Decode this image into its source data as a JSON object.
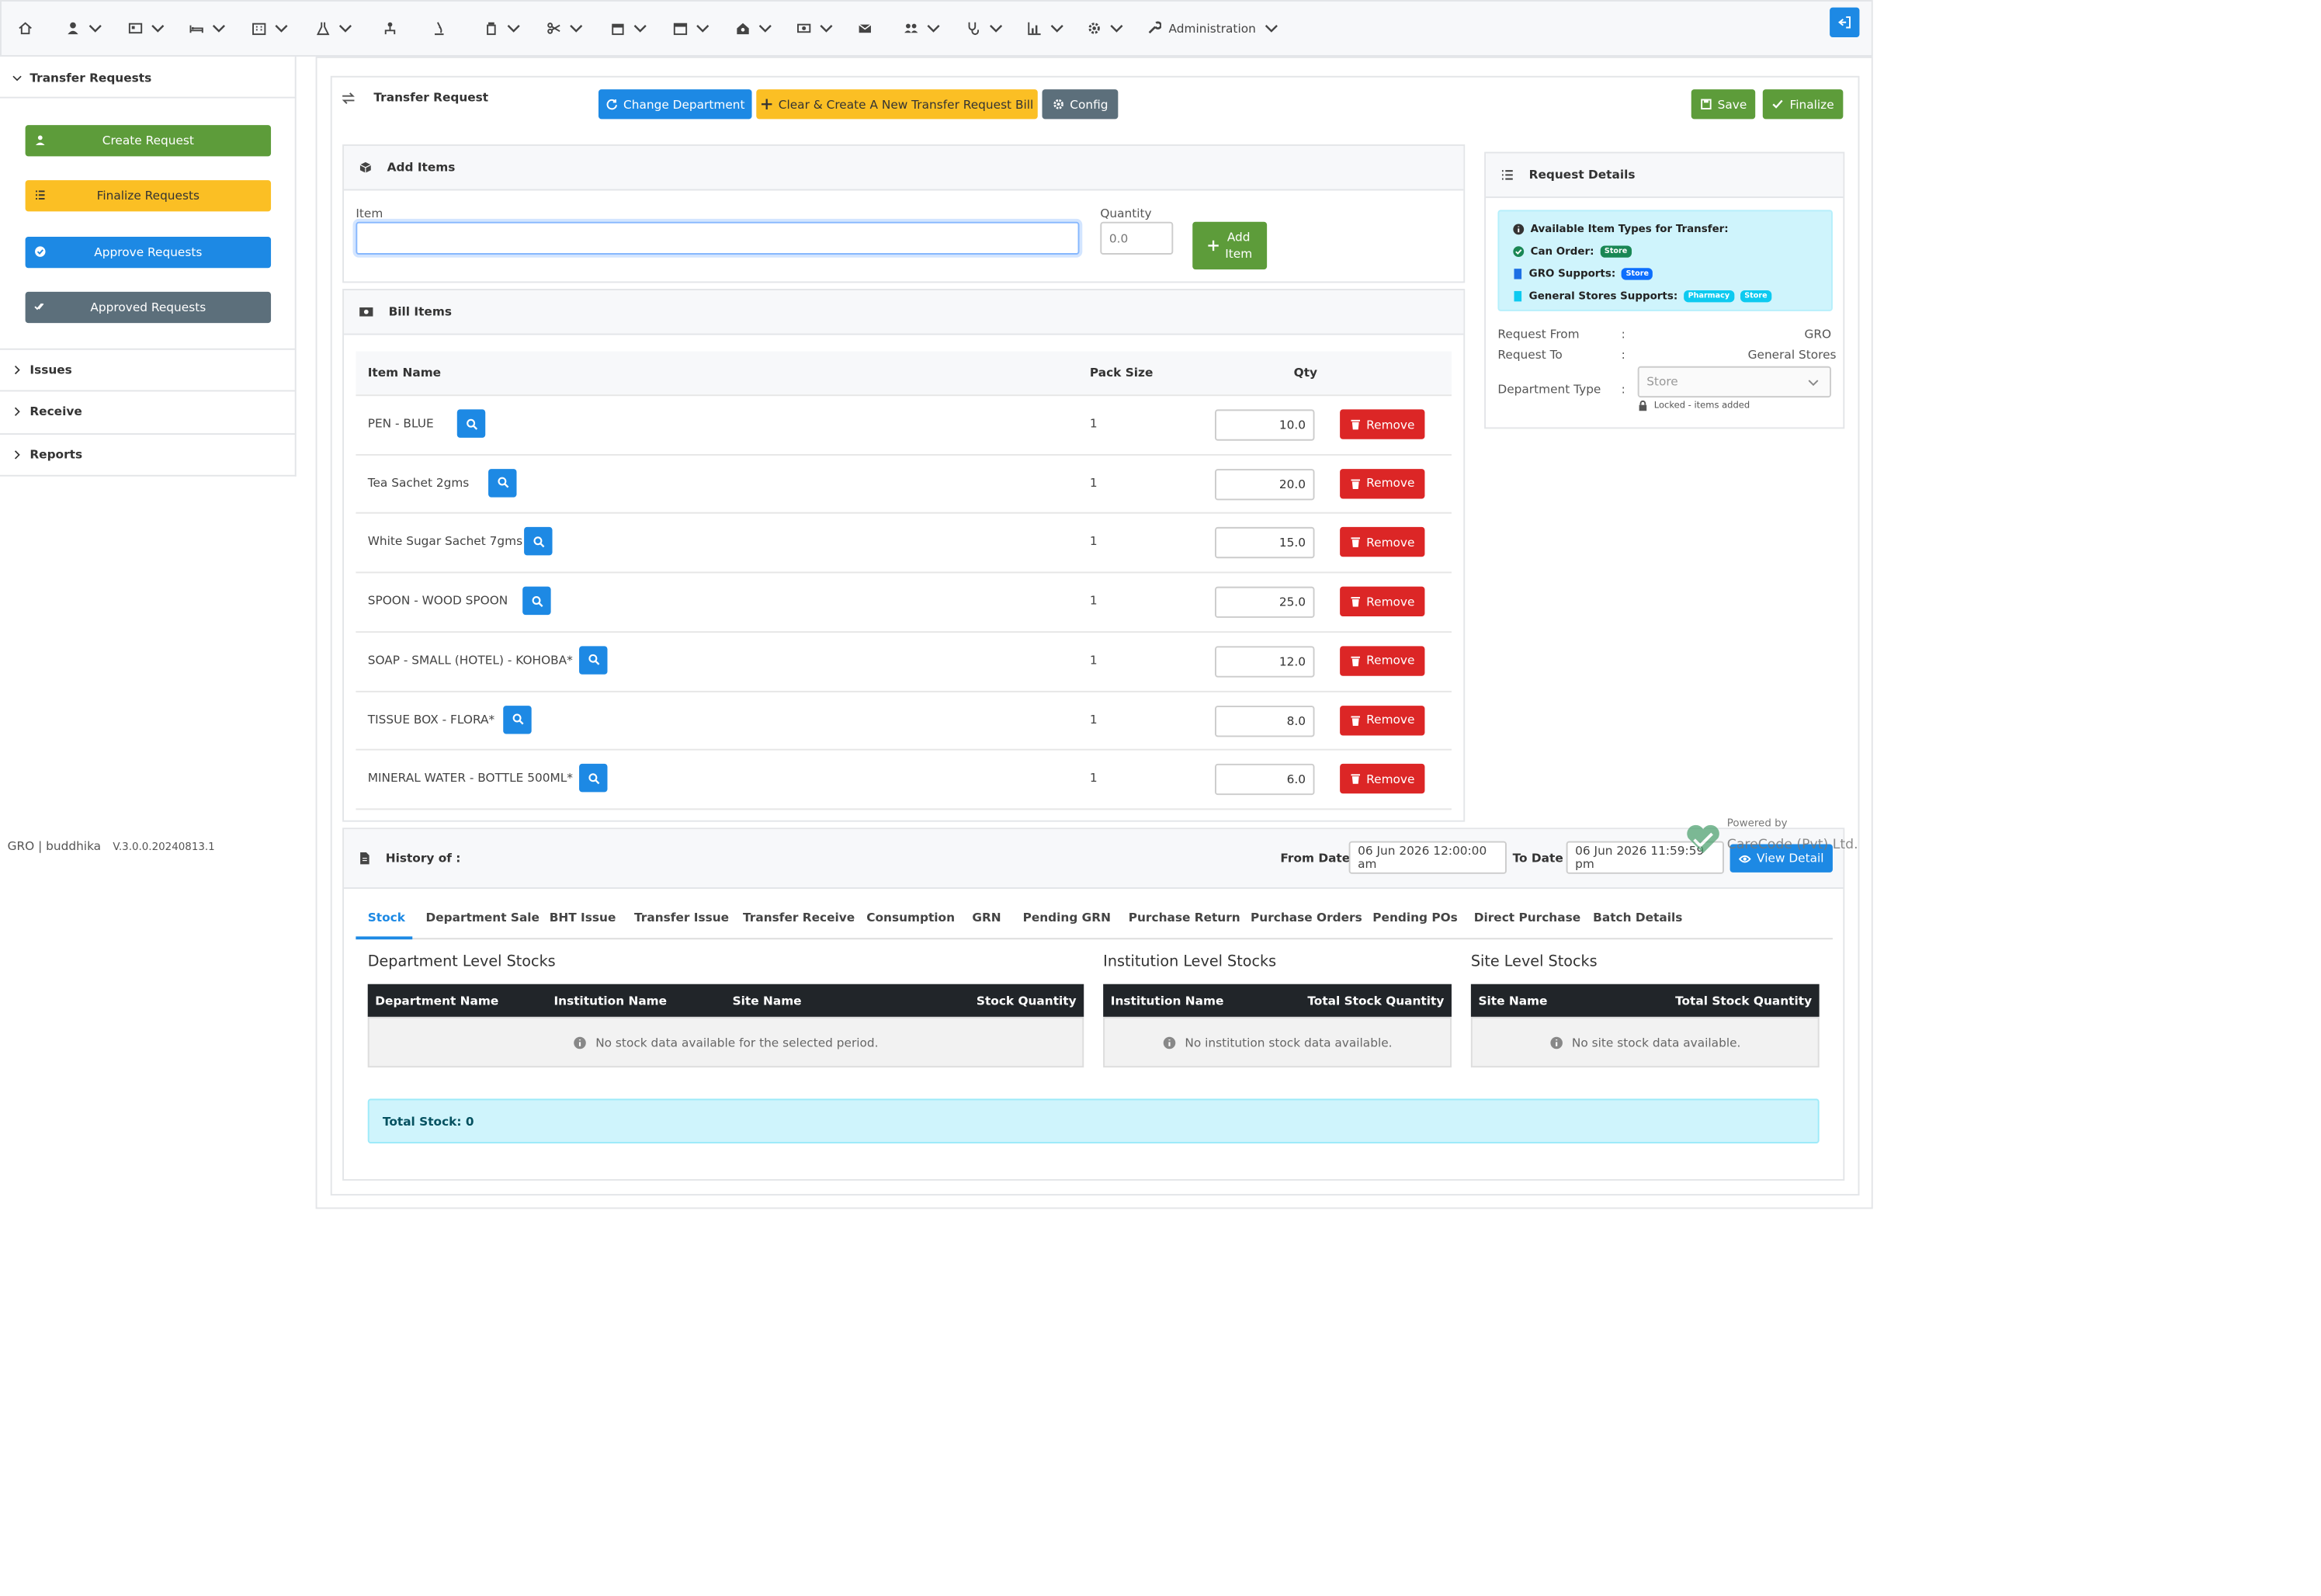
{
  "nav": {
    "administration_label": "Administration"
  },
  "sidebar": {
    "section_title": "Transfer Requests",
    "buttons": [
      "Create Request",
      "Finalize Requests",
      "Approve Requests",
      "Approved Requests"
    ],
    "sections": [
      "Issues",
      "Receive",
      "Reports"
    ]
  },
  "footer": {
    "user": "GRO | buddhika",
    "version": "V.3.0.0.20240813.1",
    "powered_by": "Powered by",
    "company": "CareCode (Pvt) Ltd."
  },
  "header": {
    "title": "Transfer Request",
    "change_department": "Change Department",
    "clear_create": "Clear & Create A New Transfer Request Bill",
    "config": "Config",
    "save": "Save",
    "finalize": "Finalize"
  },
  "add_items": {
    "title": "Add Items",
    "item_label": "Item",
    "item_value": "",
    "quantity_label": "Quantity",
    "quantity_placeholder": "0.0",
    "add_item_line1": "Add",
    "add_item_line2": "Item"
  },
  "bill_items": {
    "title": "Bill Items",
    "headers": {
      "item_name": "Item Name",
      "pack_size": "Pack Size",
      "qty": "Qty"
    },
    "remove_label": "Remove",
    "rows": [
      {
        "name": "PEN - BLUE",
        "pack": "1",
        "qty": "10.0"
      },
      {
        "name": "Tea Sachet 2gms",
        "pack": "1",
        "qty": "20.0"
      },
      {
        "name": "White Sugar Sachet 7gms",
        "pack": "1",
        "qty": "15.0"
      },
      {
        "name": "SPOON - WOOD SPOON",
        "pack": "1",
        "qty": "25.0"
      },
      {
        "name": "SOAP - SMALL (HOTEL) - KOHOBA*",
        "pack": "1",
        "qty": "12.0"
      },
      {
        "name": "TISSUE BOX - FLORA*",
        "pack": "1",
        "qty": "8.0"
      },
      {
        "name": "MINERAL WATER - BOTTLE 500ML*",
        "pack": "1",
        "qty": "6.0"
      }
    ]
  },
  "request_details": {
    "title": "Request Details",
    "info_title": "Available Item Types for Transfer:",
    "can_order_label": "Can Order:",
    "can_order_badge": "Store",
    "gro_supports_label": "GRO Supports:",
    "gro_supports_badge": "Store",
    "general_stores_label": "General Stores Supports:",
    "general_stores_badges": [
      "Pharmacy",
      "Store"
    ],
    "request_from_label": "Request From",
    "request_from_value": "GRO",
    "request_to_label": "Request To",
    "request_to_value": "General Stores",
    "department_type_label": "Department Type",
    "department_type_value": "Store",
    "locked_note": "Locked - items added",
    "colon": ":"
  },
  "history": {
    "title": "History of :",
    "from_date_label": "From Date",
    "from_date_value": "06 Jun 2026 12:00:00 am",
    "to_date_label": "To Date",
    "to_date_value": "06 Jun 2026 11:59:59 pm",
    "view_detail": "View Detail",
    "tabs": [
      "Stock",
      "Department Sale",
      "BHT Issue",
      "Transfer Issue",
      "Transfer Receive",
      "Consumption",
      "GRN",
      "Pending GRN",
      "Purchase Return",
      "Purchase Orders",
      "Pending POs",
      "Direct Purchase",
      "Batch Details"
    ],
    "active_tab": "Stock",
    "dept_title": "Department Level Stocks",
    "dept_headers": [
      "Department Name",
      "Institution Name",
      "Site Name",
      "Stock Quantity"
    ],
    "dept_empty": "No stock data available for the selected period.",
    "inst_title": "Institution Level Stocks",
    "inst_headers": [
      "Institution Name",
      "Total Stock Quantity"
    ],
    "inst_empty": "No institution stock data available.",
    "site_title": "Site Level Stocks",
    "site_headers": [
      "Site Name",
      "Total Stock Quantity"
    ],
    "site_empty": "No site stock data available.",
    "total_stock": "Total Stock: 0"
  },
  "colors": {
    "green": "#5d9c3a",
    "yellow": "#fbbf24",
    "blue": "#1d89e4",
    "grey": "#5c6f7b",
    "red": "#dc2626",
    "info_bg": "#cff4fc"
  }
}
